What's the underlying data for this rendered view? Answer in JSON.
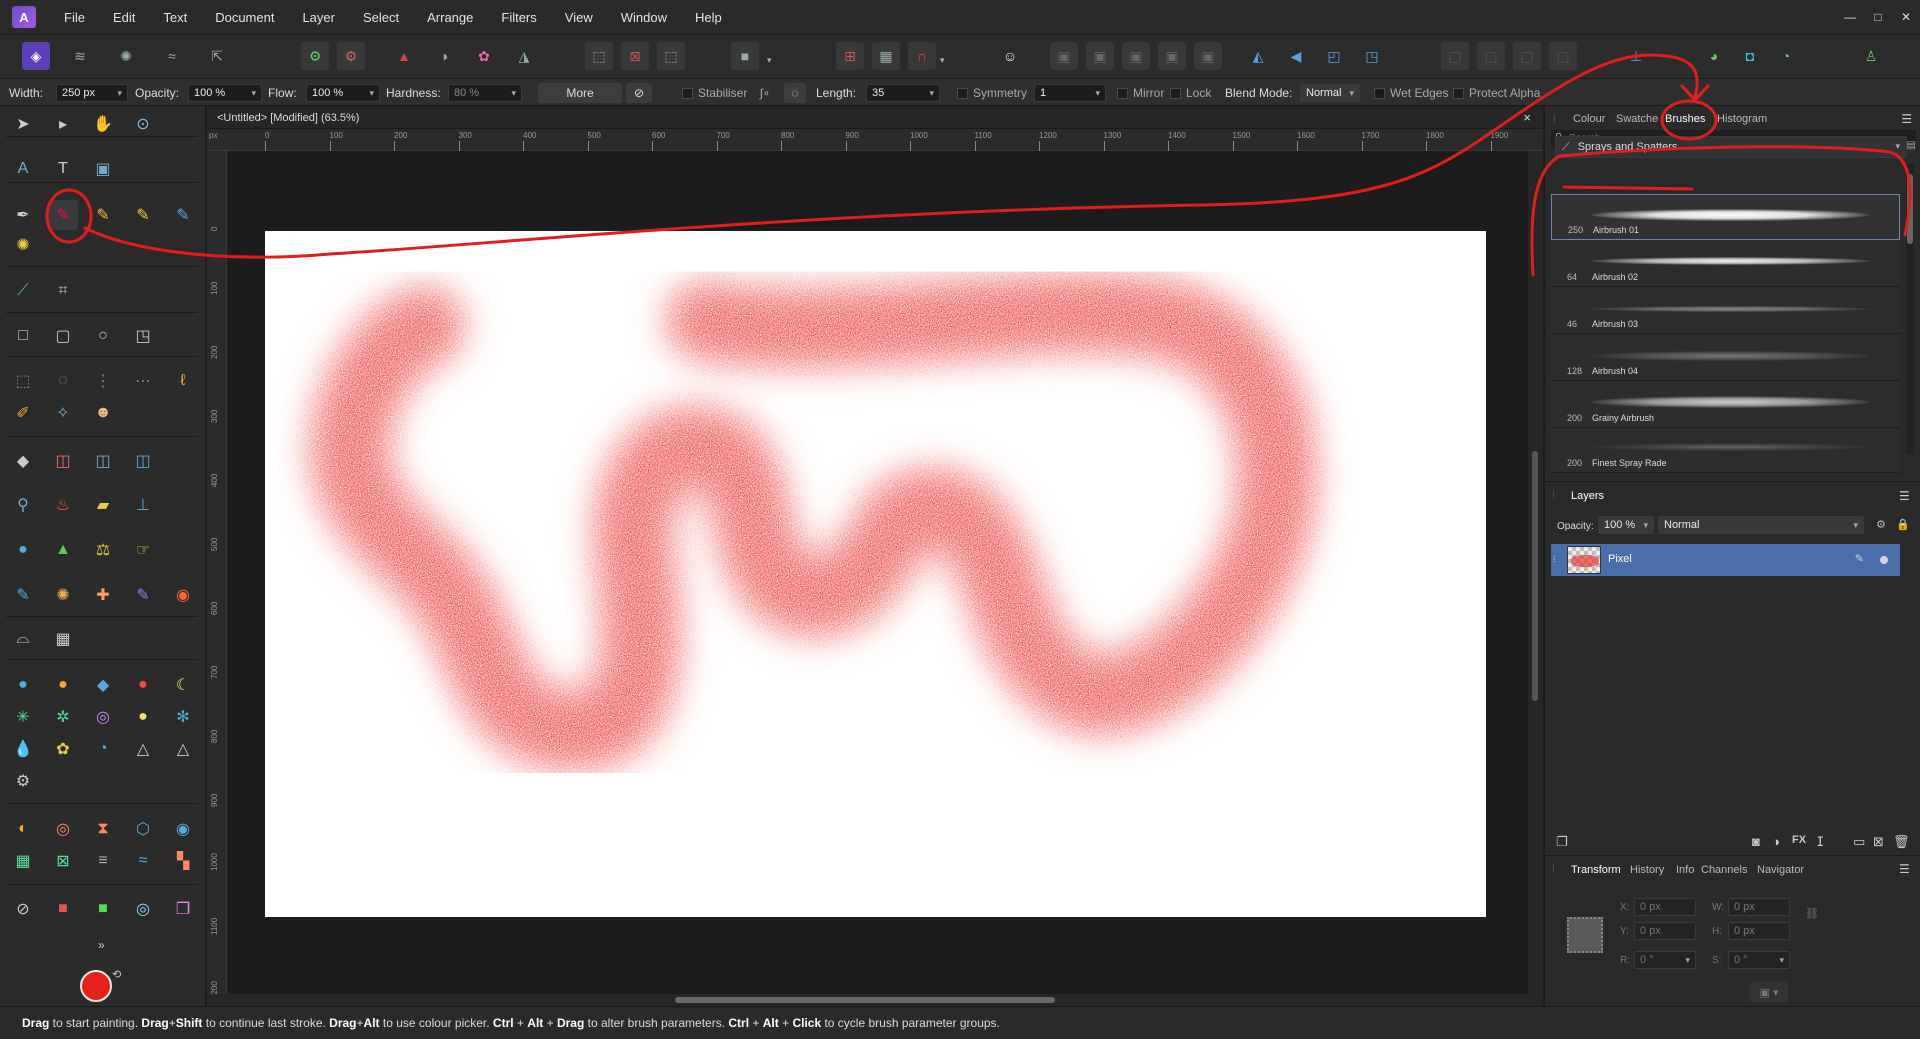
{
  "menubar": {
    "items": [
      "File",
      "Edit",
      "Text",
      "Document",
      "Layer",
      "Select",
      "Arrange",
      "Filters",
      "View",
      "Window",
      "Help"
    ],
    "window_controls": [
      "—",
      "□",
      "✕"
    ]
  },
  "context": {
    "width_label": "Width:",
    "width_value": "250 px",
    "opacity_label": "Opacity:",
    "opacity_value": "100 %",
    "flow_label": "Flow:",
    "flow_value": "100 %",
    "hardness_label": "Hardness:",
    "hardness_value": "80 %",
    "more_label": "More",
    "stabiliser_label": "Stabiliser",
    "length_label": "Length:",
    "length_value": "35",
    "symmetry_label": "Symmetry",
    "symmetry_value": "1",
    "mirror_label": "Mirror",
    "lock_label": "Lock",
    "blend_label": "Blend Mode:",
    "blend_value": "Normal",
    "wet_edges_label": "Wet Edges",
    "protect_alpha_label": "Protect Alpha"
  },
  "document": {
    "title": "<Untitled> [Modified] (63.5%)",
    "close": "×",
    "ruler_unit": "px",
    "h_ticks": [
      "0",
      "100",
      "200",
      "300",
      "400",
      "500",
      "600",
      "700",
      "800",
      "900",
      "1000",
      "1100",
      "1200",
      "1300",
      "1400",
      "1500",
      "1600",
      "1700",
      "1800",
      "1900"
    ],
    "v_ticks": [
      "0",
      "100",
      "200",
      "300",
      "400",
      "500",
      "600",
      "700",
      "800",
      "900",
      "1000",
      "1100",
      "1200"
    ],
    "brush_color": "#e8433c"
  },
  "right_panel": {
    "top_tabs": [
      "Colour",
      "Swatches",
      "Brushes",
      "Histogram"
    ],
    "active_tab": "Brushes",
    "search_placeholder": "Search",
    "category": "Sprays and Spatters",
    "brushes": [
      {
        "size": "250",
        "name": "Airbrush 01"
      },
      {
        "size": "64",
        "name": "Airbrush 02"
      },
      {
        "size": "46",
        "name": "Airbrush 03"
      },
      {
        "size": "128",
        "name": "Airbrush 04"
      },
      {
        "size": "200",
        "name": "Grainy Airbrush"
      },
      {
        "size": "200",
        "name": "Finest Spray Rade"
      }
    ],
    "layers": {
      "title": "Layers",
      "opacity_label": "Opacity:",
      "opacity_value": "100 %",
      "blend_value": "Normal",
      "layer_name": "Pixel"
    },
    "bottom_tabs": [
      "Transform",
      "History",
      "Info",
      "Channels",
      "Navigator"
    ],
    "transform": {
      "x_label": "X:",
      "x_value": "0 px",
      "y_label": "Y:",
      "y_value": "0 px",
      "w_label": "W:",
      "w_value": "0 px",
      "h_label": "H:",
      "h_value": "0 px",
      "r_label": "R:",
      "r_value": "0 °",
      "s_label": "S:",
      "s_value": "0 °"
    }
  },
  "left_panel": {
    "more_label": "»"
  },
  "status": {
    "parts": [
      {
        "b": "Drag",
        "t": " to start painting. "
      },
      {
        "b": "Drag",
        "t": "+"
      },
      {
        "b": "Shift",
        "t": " to continue last stroke. "
      },
      {
        "b": "Drag",
        "t": "+"
      },
      {
        "b": "Alt",
        "t": " to use colour picker. "
      },
      {
        "b": "Ctrl",
        "t": " + "
      },
      {
        "b": "Alt",
        "t": " + "
      },
      {
        "b": "Drag",
        "t": " to alter brush parameters. "
      },
      {
        "b": "Ctrl",
        "t": " + "
      },
      {
        "b": "Alt",
        "t": " + "
      },
      {
        "b": "Click",
        "t": " to cycle brush parameter groups."
      }
    ]
  },
  "colors": {
    "annotation_red": "#e11d1d",
    "layer_selected": "#4a6ea9",
    "accent_green": "#3fa04f"
  }
}
